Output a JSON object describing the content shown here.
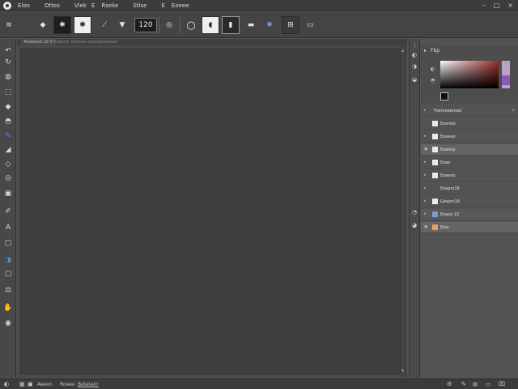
{
  "menubar": {
    "items": [
      "Eloo",
      "Ottes",
      "Vlek",
      "E",
      "Rseke",
      "Stlse",
      "E",
      "Eoeee"
    ],
    "window_controls": [
      "–",
      "□",
      "×"
    ]
  },
  "options": {
    "brush_size": "120",
    "tool_glyphs": [
      "≡",
      "◆",
      "✱",
      "⟋",
      "▼",
      "◎",
      "○",
      "◖",
      "▮",
      "▬",
      "✺",
      "⊞",
      "▭"
    ]
  },
  "tools": [
    {
      "name": "undo-icon",
      "glyph": "↶"
    },
    {
      "name": "rotate-icon",
      "glyph": "↻"
    },
    {
      "name": "lasso-icon",
      "glyph": "◍"
    },
    {
      "name": "crop-icon",
      "glyph": "⬚"
    },
    {
      "name": "tag-icon",
      "glyph": "◆"
    },
    {
      "name": "stamp-icon",
      "glyph": "◓"
    },
    {
      "name": "brush-icon",
      "glyph": "✎"
    },
    {
      "name": "bucket-icon",
      "glyph": "◢"
    },
    {
      "name": "shield-icon",
      "glyph": "◇"
    },
    {
      "name": "circle-icon",
      "glyph": "◎"
    },
    {
      "name": "frame-icon",
      "glyph": "▣"
    },
    {
      "name": "pen-icon",
      "glyph": "✐"
    },
    {
      "name": "text-icon",
      "glyph": "A"
    },
    {
      "name": "box-icon",
      "glyph": "▢"
    },
    {
      "name": "eraser-icon",
      "glyph": "◑"
    },
    {
      "name": "rounded-rect-icon",
      "glyph": "▢"
    },
    {
      "name": "scale-icon",
      "glyph": "⚖"
    },
    {
      "name": "hand-icon",
      "glyph": "✋"
    },
    {
      "name": "zoom-icon",
      "glyph": "◉"
    }
  ],
  "document": {
    "tabs": [
      "Tesbelest 19 5",
      "Vielonsf, stlnoee etonsepsessen"
    ]
  },
  "statusbar": {
    "items": [
      "Aeeon",
      "Roeeo",
      "Beteleirr"
    ]
  },
  "color_panel": {
    "header": "Fbp"
  },
  "layers": [
    {
      "name": "Feemoeeroad",
      "icon": "light"
    },
    {
      "name": "Eoerelo",
      "icon": "light"
    },
    {
      "name": "Eoeeeo",
      "icon": "light"
    },
    {
      "name": "Eeelinp",
      "icon": "light"
    },
    {
      "name": "Eoeo",
      "icon": "light"
    },
    {
      "name": "Eoeeeo",
      "icon": "light"
    },
    {
      "name": "Eeepro16",
      "icon": "light"
    },
    {
      "name": "Geeerc16",
      "icon": "light"
    },
    {
      "name": "Eoeoo 15",
      "icon": "blue"
    },
    {
      "name": "Eioe",
      "icon": "orange"
    }
  ],
  "colors": {
    "accent": "#4f8fe0",
    "hue_selected": "#8a5ab8",
    "picker_red": "#9c2b2b"
  }
}
